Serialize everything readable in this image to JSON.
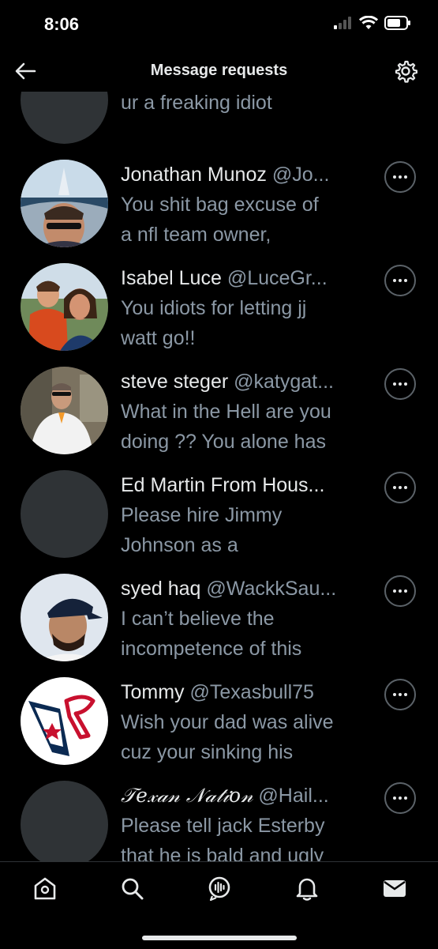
{
  "status": {
    "time": "8:06"
  },
  "header": {
    "title": "Message requests"
  },
  "top_partial_preview": "ur a freaking idiot",
  "requests": [
    {
      "name": "Jonathan Munoz",
      "handle": "@Jo...",
      "preview": [
        "You shit bag excuse of",
        "a nfl team owner,"
      ],
      "avatar": "photo-dubai-selfie"
    },
    {
      "name": "Isabel Luce",
      "handle": "@LuceGr...",
      "preview": [
        "You idiots for letting jj",
        "watt go!!"
      ],
      "avatar": "photo-mother-child"
    },
    {
      "name": "steve steger",
      "handle": "@katygat...",
      "preview": [
        "What in the Hell are you",
        "doing ?? You alone has"
      ],
      "avatar": "photo-man-white-shirt"
    },
    {
      "name": "Ed Martin From Hous...",
      "handle": "",
      "preview": [
        "Please hire Jimmy",
        "Johnson as a"
      ],
      "avatar": "default"
    },
    {
      "name": "syed haq",
      "handle": "@WackkSau...",
      "preview": [
        "I can’t believe the",
        "incompetence of this"
      ],
      "avatar": "photo-man-cap"
    },
    {
      "name": "Tommy",
      "handle": "@Texasbull75",
      "preview": [
        "Wish your dad was alive",
        "cuz your sinking his"
      ],
      "avatar": "texans-logo"
    },
    {
      "name": "𝒯𝑒𝓍𝒶𝓃 𝒩𝒶𝓉𝒾𝑜𝓃",
      "handle": "@Hail...",
      "preview": [
        "Please tell jack Esterby",
        "that he is bald and ugly"
      ],
      "avatar": "default"
    }
  ],
  "tabs": [
    "home-icon",
    "search-icon",
    "spaces-icon",
    "notifications-icon",
    "messages-icon"
  ],
  "colors": {
    "background": "#000000",
    "text": "#e7e9ea",
    "secondary": "#8b98a5",
    "avatar_placeholder": "#2f3336"
  }
}
